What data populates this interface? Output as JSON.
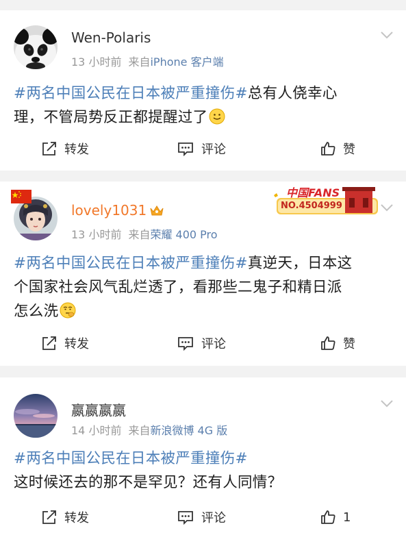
{
  "posts": [
    {
      "username": "Wen-Polaris",
      "time": "13 小时前",
      "source_prefix": "来自",
      "source": "iPhone 客户端",
      "hashtag": "#两名中国公民在日本被严重撞伤#",
      "lines": [
        "总有人侥幸心",
        "理，不管局势反正都提醒过了"
      ],
      "emoji": "smile-emoji",
      "actions": {
        "repost": "转发",
        "comment": "评论",
        "like": "赞"
      }
    },
    {
      "username": "lovely1031",
      "time": "13 小时前",
      "source_prefix": "来自",
      "source": "荣耀 400 Pro",
      "badge_title": "中国FANS",
      "badge_no": "NO.4504999",
      "hashtag": "#两名中国公民在日本被严重撞伤#",
      "lines": [
        "真逆天，日本这",
        "个国家社会风气乱烂透了，看那些二鬼子和精日派",
        "怎么洗"
      ],
      "emoji": "thinking-emoji",
      "actions": {
        "repost": "转发",
        "comment": "评论",
        "like": "赞"
      }
    },
    {
      "username": "嬴嬴嬴嬴",
      "time": "14 小时前",
      "source_prefix": "来自",
      "source": "新浪微博 4G 版",
      "hashtag": "#两名中国公民在日本被严重撞伤#",
      "lines": [
        "这时候还去的那不是罕见？还有人同情？"
      ],
      "actions": {
        "repost": "转发",
        "comment": "评论",
        "like": "1"
      }
    }
  ],
  "colors": {
    "hashtag": "#4d7fb8",
    "source_link": "#5b7fad",
    "vip_name": "#f1782a",
    "meta": "#999999",
    "background": "#f2f2f2"
  }
}
